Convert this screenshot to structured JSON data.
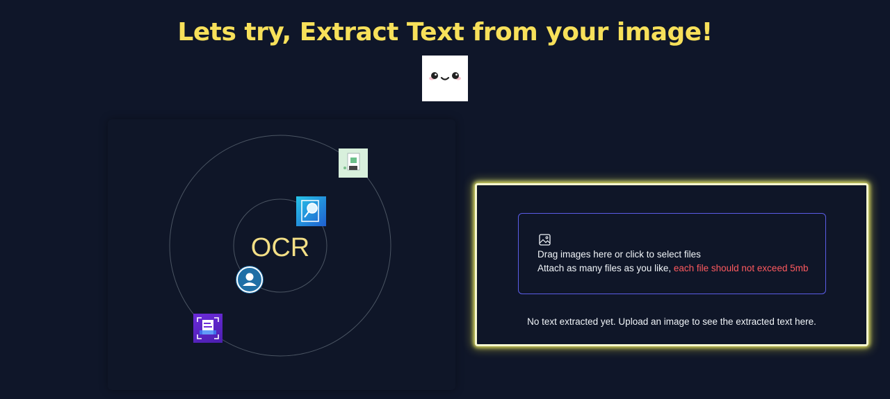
{
  "header": {
    "title": "Lets try, Extract Text from your image!",
    "mascot_icon": "kawaii-face-icon"
  },
  "orbit": {
    "center_label": "OCR",
    "icons": [
      "document-chart-icon",
      "ocr-magnifier-icon",
      "user-avatar-icon",
      "document-scan-icon"
    ]
  },
  "upload": {
    "icon": "image-icon",
    "line1": "Drag images here or click to select files",
    "line2_prefix": "Attach as many files as you like, ",
    "line2_warning": "each file should not exceed 5mb",
    "warning_color": "#ff5a5f",
    "empty_message": "No text extracted yet. Upload an image to see the extracted text here."
  },
  "colors": {
    "title": "#f7e05a",
    "background": "#0f1629",
    "card_glow": "#f0ec5a",
    "dropzone_border": "#5b5de8"
  }
}
